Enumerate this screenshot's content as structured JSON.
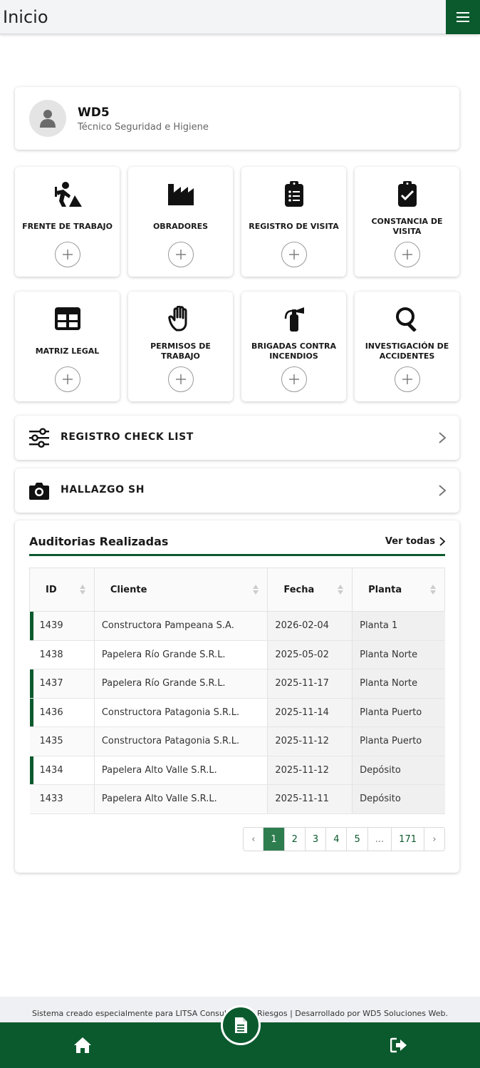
{
  "header": {
    "title": "Inicio"
  },
  "profile": {
    "name": "WD5",
    "role": "Técnico Seguridad e Higiene"
  },
  "tiles": [
    {
      "label": "FRENTE DE TRABAJO",
      "icon": "worker-icon"
    },
    {
      "label": "OBRADORES",
      "icon": "industry-icon"
    },
    {
      "label": "REGISTRO DE VISITA",
      "icon": "clipboard-list-icon"
    },
    {
      "label": "CONSTANCIA DE VISITA",
      "icon": "clipboard-check-icon"
    },
    {
      "label": "MATRIZ LEGAL",
      "icon": "table-icon"
    },
    {
      "label": "PERMISOS DE TRABAJO",
      "icon": "hand-icon"
    },
    {
      "label": "BRIGADAS CONTRA INCENDIOS",
      "icon": "fire-extinguisher-icon"
    },
    {
      "label": "INVESTIGACIÓN DE ACCIDENTES",
      "icon": "search-icon"
    }
  ],
  "list_rows": [
    {
      "label": "REGISTRO CHECK LIST",
      "icon": "sliders-icon"
    },
    {
      "label": "HALLAZGO SH",
      "icon": "camera-icon"
    }
  ],
  "audits": {
    "title": "Auditorias Realizadas",
    "view_all": "Ver todas",
    "columns": [
      "ID",
      "Cliente",
      "Fecha",
      "Planta"
    ],
    "rows": [
      {
        "id": "1439",
        "cliente": "Constructora Pampeana S.A.",
        "fecha": "2026-02-04",
        "planta": "Planta 1"
      },
      {
        "id": "1438",
        "cliente": "Papelera Río Grande S.R.L.",
        "fecha": "2025-05-02",
        "planta": "Planta Norte"
      },
      {
        "id": "1437",
        "cliente": "Papelera Río Grande S.R.L.",
        "fecha": "2025-11-17",
        "planta": "Planta Norte"
      },
      {
        "id": "1436",
        "cliente": "Constructora Patagonia S.R.L.",
        "fecha": "2025-11-14",
        "planta": "Planta Puerto"
      },
      {
        "id": "1435",
        "cliente": "Constructora Patagonia S.R.L.",
        "fecha": "2025-11-12",
        "planta": "Planta Puerto"
      },
      {
        "id": "1434",
        "cliente": "Papelera Alto Valle S.R.L.",
        "fecha": "2025-11-12",
        "planta": "Depósito"
      },
      {
        "id": "1433",
        "cliente": "Papelera Alto Valle S.R.L.",
        "fecha": "2025-11-11",
        "planta": "Depósito"
      }
    ],
    "pagination": {
      "prev": "‹",
      "pages": [
        "1",
        "2",
        "3",
        "4",
        "5",
        "...",
        "171"
      ],
      "next": "›",
      "active": "1"
    }
  },
  "footer": {
    "note": "Sistema creado especialmente para LITSA Consultora de Riesgos | Desarrollado por WD5 Soluciones Web."
  },
  "colors": {
    "brand_green": "#0b5a2e",
    "active_page": "#2e7d4f"
  }
}
